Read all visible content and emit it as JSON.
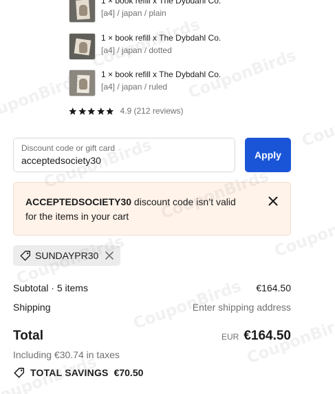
{
  "items": [
    {
      "name": "1 × book refill x The Dybdahl Co.",
      "variant": "[a4] / japan / plain"
    },
    {
      "name": "1 × book refill x The Dybdahl Co.",
      "variant": "[a4] / japan / dotted"
    },
    {
      "name": "1 × book refill x The Dybdahl Co.",
      "variant": "[a4] / japan / ruled"
    }
  ],
  "rating": {
    "stars": 5,
    "text": "4.9 (212 reviews)"
  },
  "discount": {
    "label": "Discount code or gift card",
    "value": "acceptedsociety30",
    "apply_label": "Apply"
  },
  "error": {
    "code": "ACCEPTEDSOCIETY30",
    "message_part1": " discount code isn’t valid",
    "message_part2": "for the items in your cart"
  },
  "applied_code": "SUNDAYPR30",
  "summary": {
    "subtotal_label": "Subtotal · 5 items",
    "subtotal_value": "€164.50",
    "shipping_label": "Shipping",
    "shipping_value": "Enter shipping address",
    "total_label": "Total",
    "currency": "EUR",
    "total_value": "€164.50",
    "taxes": "Including €30.74 in taxes",
    "savings_label": "TOTAL SAVINGS",
    "savings_value": "€70.50"
  },
  "watermark": "CouponBirds",
  "colors": {
    "accent": "#1a55d8",
    "error_bg": "#fff3ea",
    "chip_bg": "#ececec"
  }
}
